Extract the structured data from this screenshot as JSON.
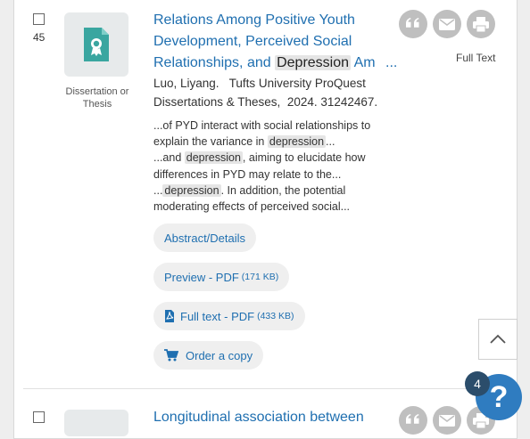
{
  "result1": {
    "number": "45",
    "doc_type": "Dissertation or Thesis",
    "title_part1": "Relations Among Positive Youth Development, Perceived Social Relationships, and",
    "title_highlight": "Depression",
    "title_part2": "Am",
    "title_more": "...",
    "author": "Luo, Liyang.",
    "source": "Tufts University ProQuest Dissertations & Theses,",
    "year_id": "2024. 31242467.",
    "abstract": {
      "s1": "...of PYD interact with social relationships to explain the variance in",
      "h1": "depression",
      "s2": "...",
      "s3": "...and",
      "h2": "depression",
      "s4": ", aiming to elucidate how differences in PYD may relate to the...",
      "s5": "...",
      "h3": "depression",
      "s6": ". In addition, the potential moderating effects of perceived social..."
    },
    "links": {
      "abstract_details": "Abstract/Details",
      "preview_pdf": "Preview - PDF",
      "preview_size": "(171 KB)",
      "full_text_pdf": "Full text - PDF",
      "full_text_size": "(433 KB)",
      "order_copy": "Order a copy"
    },
    "full_text_label": "Full Text"
  },
  "result2": {
    "title_part1": "Longitudinal association between"
  },
  "widgets": {
    "help_badge_count": "4",
    "help_symbol": "?"
  }
}
